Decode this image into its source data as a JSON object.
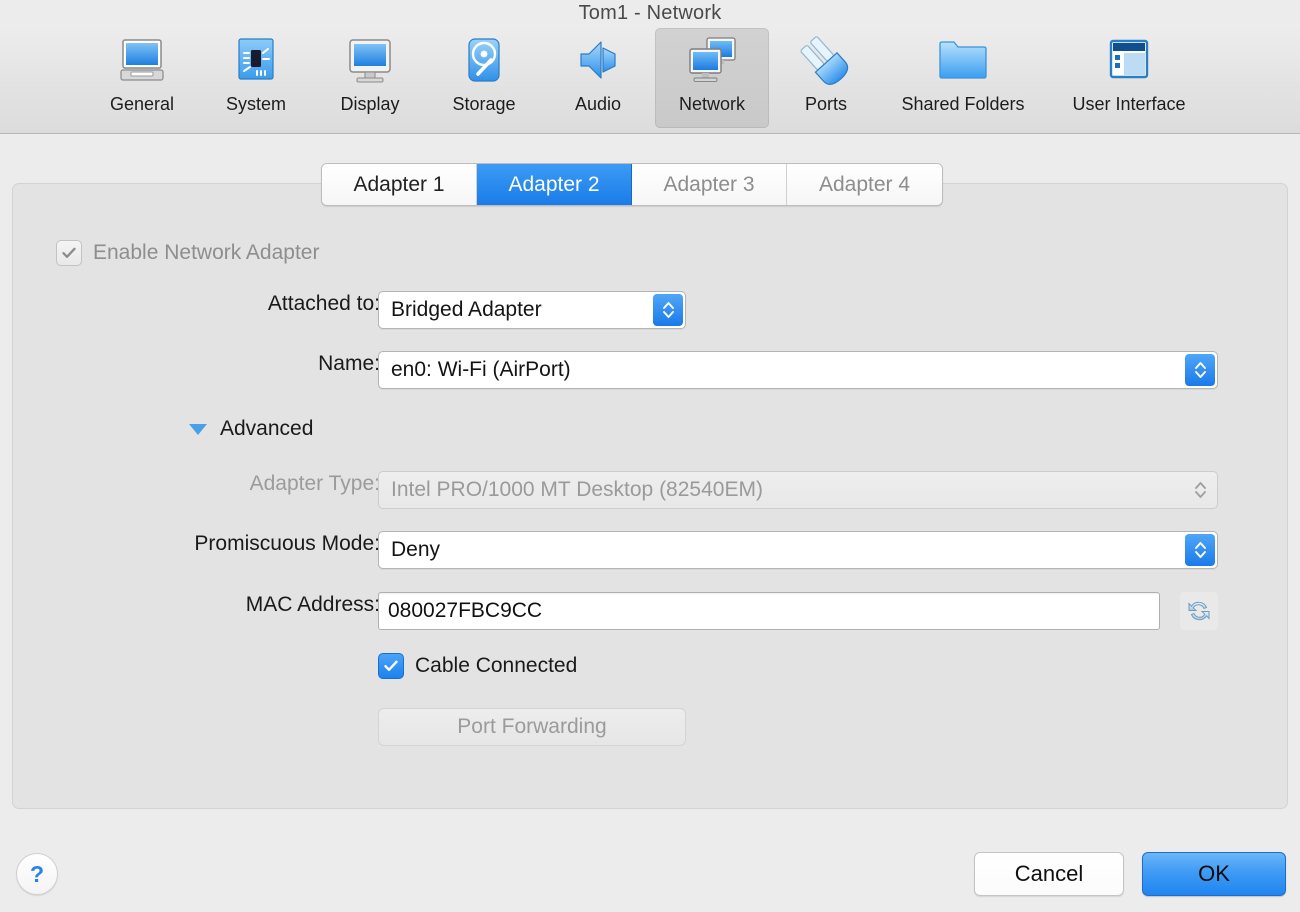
{
  "window": {
    "title": "Tom1 - Network"
  },
  "toolbar": {
    "items": [
      {
        "label": "General",
        "icon": "general-icon",
        "selected": false
      },
      {
        "label": "System",
        "icon": "system-icon",
        "selected": false
      },
      {
        "label": "Display",
        "icon": "display-icon",
        "selected": false
      },
      {
        "label": "Storage",
        "icon": "storage-icon",
        "selected": false
      },
      {
        "label": "Audio",
        "icon": "audio-icon",
        "selected": false
      },
      {
        "label": "Network",
        "icon": "network-icon",
        "selected": true
      },
      {
        "label": "Ports",
        "icon": "ports-icon",
        "selected": false
      },
      {
        "label": "Shared Folders",
        "icon": "shared-folders-icon",
        "selected": false
      },
      {
        "label": "User Interface",
        "icon": "user-interface-icon",
        "selected": false
      }
    ]
  },
  "tabs": [
    {
      "label": "Adapter 1",
      "state": "normal"
    },
    {
      "label": "Adapter 2",
      "state": "active"
    },
    {
      "label": "Adapter 3",
      "state": "dim"
    },
    {
      "label": "Adapter 4",
      "state": "dim"
    }
  ],
  "form": {
    "enable_adapter": {
      "label": "Enable Network Adapter",
      "checked": true,
      "enabled": false
    },
    "attached_to": {
      "label": "Attached to:",
      "value": "Bridged Adapter",
      "enabled": true
    },
    "name": {
      "label": "Name:",
      "value": "en0: Wi-Fi (AirPort)",
      "enabled": true
    },
    "advanced": {
      "label": "Advanced",
      "expanded": true
    },
    "adapter_type": {
      "label": "Adapter Type:",
      "value": "Intel PRO/1000 MT Desktop (82540EM)",
      "enabled": false
    },
    "promiscuous_mode": {
      "label": "Promiscuous Mode:",
      "value": "Deny",
      "enabled": true
    },
    "mac_address": {
      "label": "MAC Address:",
      "value": "080027FBC9CC",
      "placeholder": "",
      "refresh_icon": "refresh-icon"
    },
    "cable_connected": {
      "label": "Cable Connected",
      "checked": true,
      "enabled": true
    },
    "port_forwarding": {
      "label": "Port Forwarding",
      "enabled": false
    }
  },
  "buttons": {
    "help": "?",
    "cancel": "Cancel",
    "ok": "OK"
  },
  "colors": {
    "accent_blue": "#1a7ce8",
    "page_background": "#ececec",
    "panel_background": "#e3e3e3",
    "disabled_text": "#9b9b9b"
  }
}
